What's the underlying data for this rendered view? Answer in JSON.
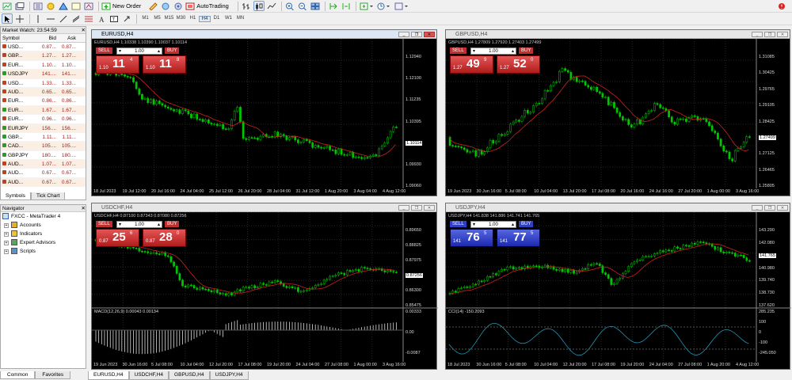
{
  "toolbar": {
    "new_order": "New Order",
    "auto_trading": "AutoTrading",
    "timeframes": [
      "M1",
      "M5",
      "M15",
      "M30",
      "H1",
      "H4",
      "D1",
      "W1",
      "MN"
    ],
    "active_timeframe": "H4"
  },
  "market_watch": {
    "title": "Market Watch: 23:54:59",
    "cols": [
      "Symbol",
      "Bid",
      "Ask"
    ],
    "rows": [
      {
        "s": "USD...",
        "b": "0.87...",
        "a": "0.87...",
        "up": false
      },
      {
        "s": "GBP...",
        "b": "1.27...",
        "a": "1.27...",
        "up": false
      },
      {
        "s": "EUR...",
        "b": "1.10...",
        "a": "1.10...",
        "up": false
      },
      {
        "s": "USDJPY",
        "b": "141....",
        "a": "141....",
        "up": true
      },
      {
        "s": "USD...",
        "b": "1.33...",
        "a": "1.33...",
        "up": false
      },
      {
        "s": "AUD...",
        "b": "0.65...",
        "a": "0.65...",
        "up": false
      },
      {
        "s": "EUR...",
        "b": "0.86...",
        "a": "0.86...",
        "up": false
      },
      {
        "s": "EUR...",
        "b": "1.67...",
        "a": "1.67...",
        "up": true
      },
      {
        "s": "EUR...",
        "b": "0.96...",
        "a": "0.96...",
        "up": false
      },
      {
        "s": "EURJPY",
        "b": "156....",
        "a": "156....",
        "up": true
      },
      {
        "s": "GBP...",
        "b": "1.11...",
        "a": "1.11...",
        "up": true
      },
      {
        "s": "CAD...",
        "b": "105....",
        "a": "105....",
        "up": true
      },
      {
        "s": "GBPJPY",
        "b": "180....",
        "a": "180....",
        "up": true
      },
      {
        "s": "AUD...",
        "b": "1.07...",
        "a": "1.07...",
        "up": false
      },
      {
        "s": "AUD...",
        "b": "0.67...",
        "a": "0.67...",
        "up": false
      },
      {
        "s": "AUD...",
        "b": "0.67...",
        "a": "0.67...",
        "up": false
      }
    ],
    "tabs": [
      "Symbols",
      "Tick Chart"
    ]
  },
  "navigator": {
    "title": "Navigator",
    "root": "FXCC - MetaTrader 4",
    "items": [
      "Accounts",
      "Indicators",
      "Expert Advisors",
      "Scripts"
    ],
    "tabs": [
      "Common",
      "Favorites"
    ]
  },
  "charts": [
    {
      "title": "EURUSD,H4",
      "info": "EURUSD,H4  1.10338 1.10390 1.10037 1.10114",
      "sell_small": "1.10",
      "sell_big": "11",
      "sell_pip": "4",
      "buy_small": "1.10",
      "buy_big": "11",
      "buy_pip": "8",
      "lot": "1.00",
      "sell": "SELL",
      "buy": "BUY",
      "theme": "red",
      "active": true,
      "prices": [
        "1.12940",
        "1.12100",
        "1.11235",
        "1.10395",
        "1.10114",
        "1.09930",
        "1.09060"
      ],
      "last": "1.10114",
      "dates": [
        "18 Jul 2023",
        "19 Jul 12:00",
        "20 Jul 16:00",
        "24 Jul 04:00",
        "25 Jul 12:00",
        "26 Jul 20:00",
        "28 Jul 04:00",
        "31 Jul 12:00",
        "1 Aug 20:00",
        "3 Aug 04:00",
        "4 Aug 12:00"
      ]
    },
    {
      "title": "GBPUSD,H4",
      "info": "GBPUSD,H4  1.27809 1.27920 1.27403 1.27499",
      "sell_small": "1.27",
      "sell_big": "49",
      "sell_pip": "9",
      "buy_small": "1.27",
      "buy_big": "52",
      "buy_pip": "0",
      "lot": "1.00",
      "sell": "SELL",
      "buy": "BUY",
      "theme": "red",
      "active": false,
      "prices": [
        "1.31085",
        "1.30425",
        "1.29765",
        "1.29105",
        "1.28425",
        "1.27499",
        "1.27125",
        "1.26465",
        "1.25805"
      ],
      "last": "1.27499",
      "dates": [
        "19 Jun 2023",
        "30 Jun 16:00",
        "5 Jul 08:00",
        "10 Jul 04:00",
        "13 Jul 20:00",
        "17 Jul 08:00",
        "20 Jul 16:00",
        "24 Jul 16:00",
        "27 Jul 20:00",
        "1 Aug 00:00",
        "3 Aug 16:00"
      ]
    },
    {
      "title": "USDCHF,H4",
      "info": "USDCHF,H4  0.87100 0.87343 0.87080 0.87256",
      "sell_small": "0.87",
      "sell_big": "25",
      "sell_pip": "6",
      "buy_small": "0.87",
      "buy_big": "28",
      "buy_pip": "0",
      "lot": "1.00",
      "sell": "SELL",
      "buy": "BUY",
      "theme": "red",
      "active": false,
      "prices": [
        "0.89650",
        "0.88825",
        "0.87975",
        "0.87256",
        "0.86300",
        "0.85475"
      ],
      "last": "0.87256",
      "macd": "MACD(12,26,9) 0.00043 0.00134",
      "macd_axis": [
        "0.00333",
        "0.00",
        "-0.0087"
      ],
      "dates": [
        "19 Jun 2023",
        "30 Jun 16:00",
        "5 Jul 08:00",
        "10 Jul 04:00",
        "12 Jul 20:00",
        "17 Jul 08:00",
        "19 Jul 20:00",
        "24 Jul 04:00",
        "27 Jul 08:00",
        "1 Aug 00:00",
        "3 Aug 16:00"
      ]
    },
    {
      "title": "USDJPY,H4",
      "info": "USDJPY,H4  141.838 141.886 141.741 141.765",
      "sell_small": "141",
      "sell_big": "76",
      "sell_pip": "5",
      "buy_small": "141",
      "buy_big": "77",
      "buy_pip": "5",
      "lot": "1.00",
      "sell": "SELL",
      "buy": "BUY",
      "theme": "blue",
      "active": false,
      "prices": [
        "143.290",
        "142.080",
        "141.765",
        "140.980",
        "139.740",
        "138.730",
        "137.620"
      ],
      "last": "141.765",
      "cci": "CCI(14) -150.2093",
      "cci_axis": [
        "285.235",
        "100",
        "0",
        "-100",
        "-245.050"
      ],
      "dates": [
        "18 Jul 2023",
        "30 Jun 16:00",
        "5 Jul 08:00",
        "10 Jul 04:00",
        "12 Jul 20:00",
        "17 Jul 08:00",
        "19 Jul 20:00",
        "24 Jul 04:00",
        "27 Jul 08:00",
        "1 Aug 20:00",
        "4 Aug 12:00"
      ]
    }
  ],
  "bottom_tabs": [
    "EURUSD,H4",
    "USDCHF,H4",
    "GBPUSD,H4",
    "USDJPY,H4"
  ],
  "bottom_active": "EURUSD,H4",
  "colors": {
    "candle": "#00c800",
    "ma": "#d02020",
    "grid": "#2a2a2a",
    "sell_red": "#c82828",
    "buy_blue": "#2838c8"
  }
}
